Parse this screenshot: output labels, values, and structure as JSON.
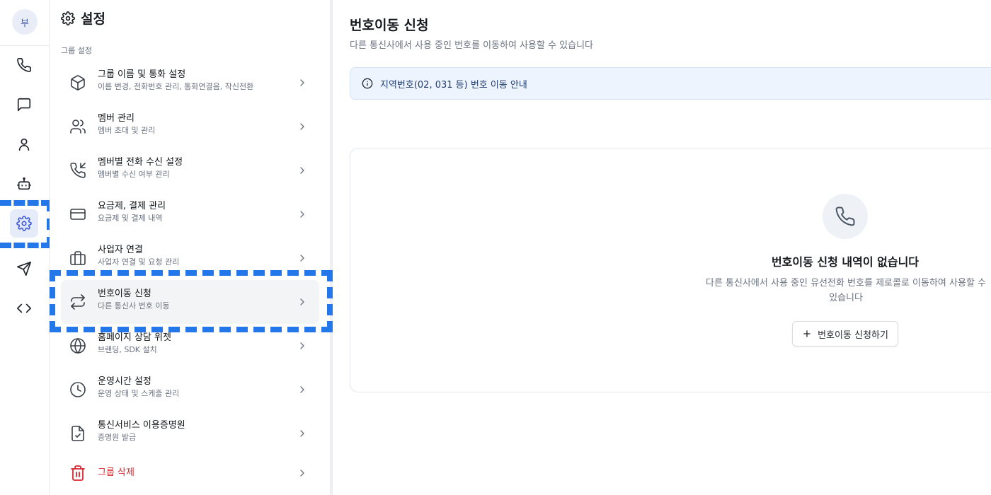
{
  "rail": {
    "avatar_initial": "부",
    "items": [
      {
        "icon": "phone-icon",
        "active": false
      },
      {
        "icon": "message-icon",
        "active": false
      },
      {
        "icon": "user-icon",
        "active": false
      },
      {
        "icon": "bot-icon",
        "active": false
      },
      {
        "icon": "gear-icon",
        "active": true
      },
      {
        "icon": "send-icon",
        "active": false
      },
      {
        "icon": "code-icon",
        "active": false
      }
    ]
  },
  "settings": {
    "title": "설정",
    "section_label": "그룹 설정",
    "items": [
      {
        "icon": "box-icon",
        "title": "그룹 이름 및 통화 설정",
        "subtitle": "이름 변경, 전화번호 관리, 통화연결음, 착신전환"
      },
      {
        "icon": "users-icon",
        "title": "멤버 관리",
        "subtitle": "멤버 초대 및 관리"
      },
      {
        "icon": "phone-incoming-icon",
        "title": "멤버별 전화 수신 설정",
        "subtitle": "멤버별 수신 여부 관리"
      },
      {
        "icon": "credit-card-icon",
        "title": "요금제, 결제 관리",
        "subtitle": "요금제 및 결제 내역"
      },
      {
        "icon": "briefcase-icon",
        "title": "사업자 연결",
        "subtitle": "사업자 연결 및 요청 관리"
      },
      {
        "icon": "transfer-arrows-icon",
        "title": "번호이동 신청",
        "subtitle": "다른 통신사 번호 이동"
      },
      {
        "icon": "globe-icon",
        "title": "홈페이지 상담 위젯",
        "subtitle": "브랜딩, SDK 설치"
      },
      {
        "icon": "clock-icon",
        "title": "운영시간 설정",
        "subtitle": "운영 상태 및 스케줄 관리"
      },
      {
        "icon": "file-check-icon",
        "title": "통신서비스 이용증명원",
        "subtitle": "증명원 발급"
      },
      {
        "icon": "trash-icon",
        "title": "그룹 삭제",
        "subtitle": ""
      }
    ]
  },
  "main": {
    "title": "번호이동 신청",
    "subtitle": "다른 통신사에서 사용 중인 번호를 이동하여 사용할 수 있습니다",
    "info_banner": "지역번호(02, 031 등) 번호 이동 안내",
    "empty": {
      "title": "번호이동 신청 내역이 없습니다",
      "description": "다른 통신사에서 사용 중인 유선전화 번호를 제로콜로 이동하여 사용할 수 있습니다",
      "button": "번호이동 신청하기"
    }
  },
  "colors": {
    "accent": "#3f5bd9",
    "annotation_dash": "#2477e8",
    "danger": "#d9272e",
    "info_bg": "#eef4fd"
  }
}
